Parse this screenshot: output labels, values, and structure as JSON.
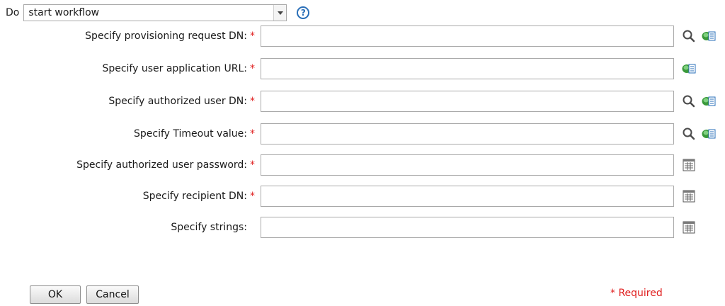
{
  "action": {
    "label": "Do",
    "selected": "start workflow"
  },
  "fields": [
    {
      "label": "Specify provisioning request DN:",
      "required": true,
      "value": "",
      "icons": [
        "search-icon",
        "variable-icon"
      ]
    },
    {
      "label": "Specify user application URL:",
      "required": true,
      "value": "",
      "icons": [
        "variable-icon"
      ]
    },
    {
      "label": "Specify authorized user DN:",
      "required": true,
      "value": "",
      "icons": [
        "search-icon",
        "variable-icon"
      ]
    },
    {
      "label": "Specify Timeout value:",
      "required": true,
      "value": "",
      "icons": [
        "search-icon",
        "variable-icon"
      ]
    },
    {
      "label": "Specify authorized user password:",
      "required": true,
      "value": "",
      "icons": [
        "list-editor-icon"
      ]
    },
    {
      "label": "Specify recipient DN:",
      "required": true,
      "value": "",
      "icons": [
        "list-editor-icon"
      ]
    },
    {
      "label": "Specify strings:",
      "required": false,
      "value": "",
      "icons": [
        "list-editor-icon"
      ]
    }
  ],
  "required_marker": "*",
  "buttons": {
    "ok": "OK",
    "cancel": "Cancel"
  },
  "required_note": "* Required",
  "colors": {
    "required": "#e02020",
    "help": "#2a6fb8"
  }
}
